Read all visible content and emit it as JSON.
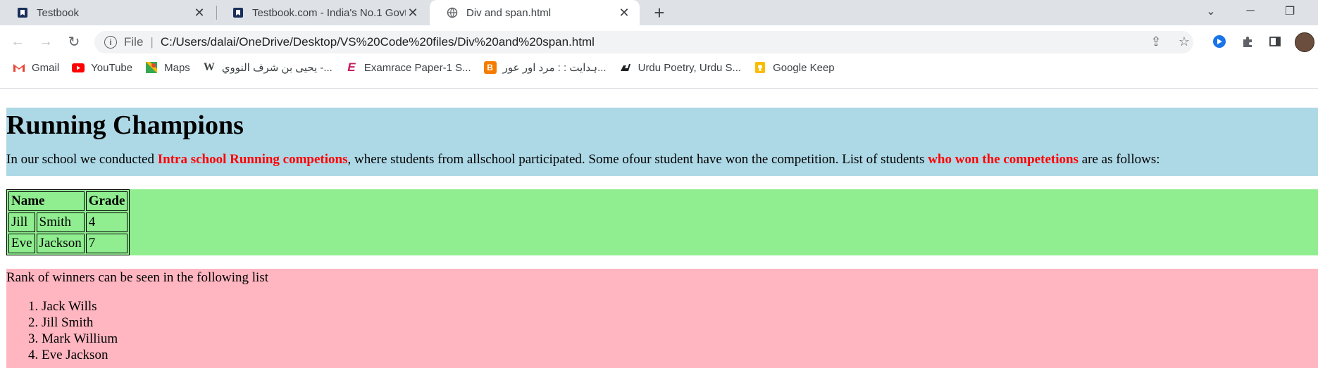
{
  "browser": {
    "tabs": [
      {
        "title": "Testbook",
        "favicon": "testbook-icon",
        "active": false
      },
      {
        "title": "Testbook.com - India's No.1 Govt",
        "favicon": "testbook-icon",
        "active": false
      },
      {
        "title": "Div and span.html",
        "favicon": "globe-icon",
        "active": true
      }
    ],
    "address_bar": {
      "scheme": "File",
      "url": "C:/Users/dalai/OneDrive/Desktop/VS%20Code%20files/Div%20and%20span.html"
    },
    "bookmarks": [
      {
        "label": "Gmail",
        "icon": "gmail-icon"
      },
      {
        "label": "YouTube",
        "icon": "youtube-icon"
      },
      {
        "label": "Maps",
        "icon": "maps-icon"
      },
      {
        "label": "يحيى بن شرف النووي -...",
        "icon": "wikipedia-icon"
      },
      {
        "label": "Examrace Paper-1 S...",
        "icon": "examrace-icon"
      },
      {
        "label": "ہدایت : : مرد اور عور...",
        "icon": "blogger-icon"
      },
      {
        "label": "Urdu Poetry, Urdu S...",
        "icon": "rekhta-icon"
      },
      {
        "label": "Google Keep",
        "icon": "keep-icon"
      }
    ]
  },
  "page": {
    "heading": "Running Champions",
    "intro": {
      "part1": "In our school we conducted ",
      "highlight1": "Intra school Running competions",
      "part2": ", where students from allschool participated. Some ofour student have won the competition. List of students ",
      "highlight2": "who won the competetions",
      "part3": " are as follows:"
    },
    "table": {
      "headers": [
        "Name",
        "Grade"
      ],
      "rows": [
        {
          "first": "Jill",
          "last": "Smith",
          "grade": "4"
        },
        {
          "first": "Eve",
          "last": "Jackson",
          "grade": "7"
        }
      ]
    },
    "rank_intro": "Rank of winners can be seen in the following list",
    "ranks": [
      "Jack Wills",
      "Jill Smith",
      "Mark Willium",
      "Eve Jackson"
    ]
  },
  "colors": {
    "blue_block": "#add8e6",
    "green_block": "#90ee90",
    "pink_block": "#ffb6c1",
    "highlight": "#ff0000"
  }
}
